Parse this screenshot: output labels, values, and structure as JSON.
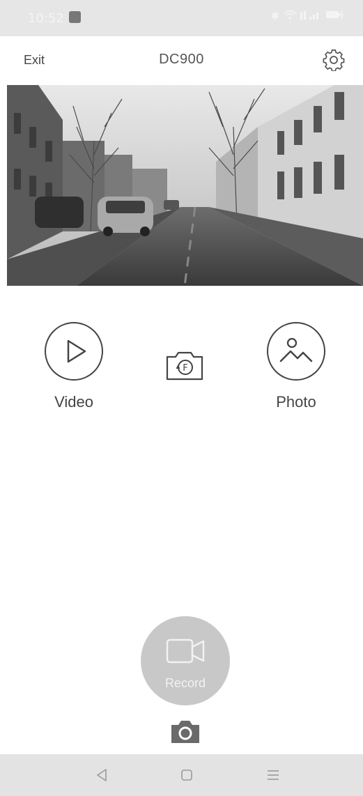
{
  "status_bar": {
    "time": "10:52",
    "icons": [
      "bluetooth-icon",
      "wifi-icon",
      "signal-icon",
      "battery-charging-icon"
    ]
  },
  "header": {
    "exit_label": "Exit",
    "title": "DC900",
    "settings_icon": "gear-icon"
  },
  "preview": {
    "description_icon": "camera-live-view"
  },
  "modes": {
    "video_label": "Video",
    "photo_label": "Photo",
    "switch_camera_icon": "camera-switch-front-icon"
  },
  "record": {
    "label": "Record",
    "icon": "video-camera-icon",
    "button_color": "#c8c8c8"
  },
  "snapshot": {
    "icon": "camera-icon"
  },
  "nav": {
    "back_icon": "back-triangle-icon",
    "home_icon": "home-square-icon",
    "menu_icon": "menu-lines-icon"
  },
  "colors": {
    "statusbar_bg": "#e6e6e6",
    "navbar_bg": "#e3e3e3",
    "text": "#444444"
  }
}
